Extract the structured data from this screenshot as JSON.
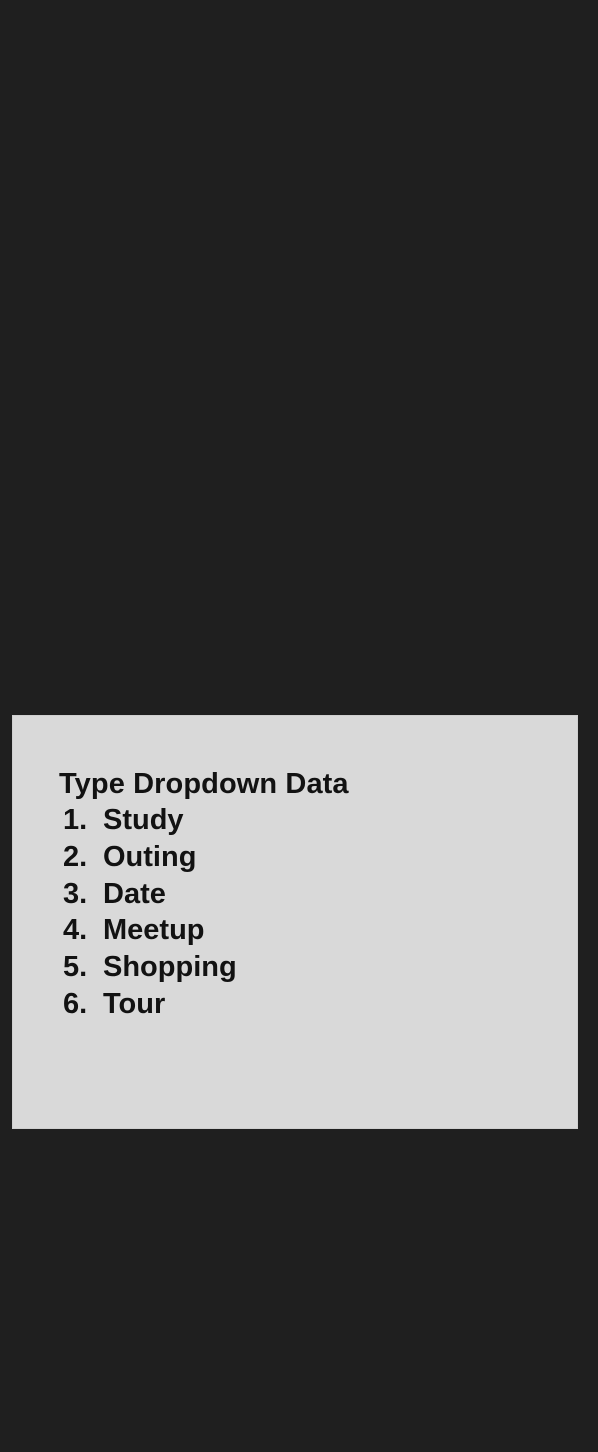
{
  "card": {
    "title": "Type Dropdown Data",
    "items": [
      {
        "number": "1.",
        "label": "Study"
      },
      {
        "number": "2.",
        "label": "Outing"
      },
      {
        "number": "3.",
        "label": "Date"
      },
      {
        "number": "4.",
        "label": "Meetup"
      },
      {
        "number": "5.",
        "label": "Shopping"
      },
      {
        "number": "6.",
        "label": "Tour"
      }
    ]
  },
  "colors": {
    "page_background": "#1f1f1f",
    "card_background": "#d9d9d9",
    "text": "#121212"
  }
}
